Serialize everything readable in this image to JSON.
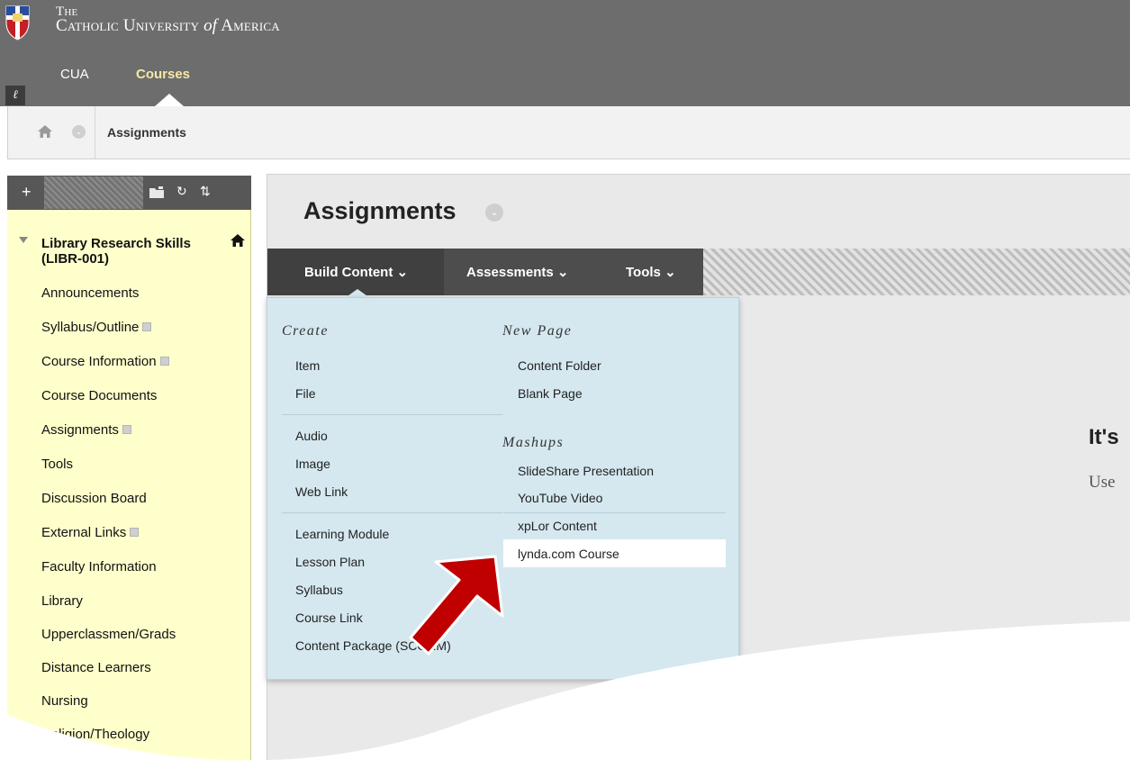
{
  "header": {
    "university_line1": "The",
    "university_line2a": "Catholic University ",
    "university_line2b": "of",
    "university_line2c": " America",
    "tabs": [
      {
        "label": "CUA"
      },
      {
        "label": "Courses"
      }
    ]
  },
  "breadcrumb": {
    "current": "Assignments"
  },
  "course_menu": {
    "course_title_line1": "Library Research Skills",
    "course_title_line2": "(LIBR-001)",
    "items": [
      {
        "label": "Announcements",
        "hidden": false
      },
      {
        "label": "Syllabus/Outline",
        "hidden": true
      },
      {
        "label": "Course Information",
        "hidden": true
      },
      {
        "label": "Course Documents",
        "hidden": false
      },
      {
        "label": "Assignments",
        "hidden": true
      },
      {
        "label": "Tools",
        "hidden": false
      },
      {
        "label": "Discussion Board",
        "hidden": false
      },
      {
        "label": "External Links",
        "hidden": true
      },
      {
        "label": "Faculty Information",
        "hidden": false
      },
      {
        "label": "Library",
        "hidden": false
      },
      {
        "label": "Upperclassmen/Grads",
        "hidden": false
      },
      {
        "label": "Distance Learners",
        "hidden": false
      },
      {
        "label": "Nursing",
        "hidden": false
      },
      {
        "label": "Religion/Theology",
        "hidden": false
      }
    ]
  },
  "content": {
    "page_title": "Assignments",
    "actions": {
      "build": "Build Content",
      "assessments": "Assessments",
      "tools": "Tools"
    },
    "empty_heading": "It's",
    "empty_sub": "Use"
  },
  "dropdown": {
    "create_heading": "Create",
    "new_page_heading": "New Page",
    "mashups_heading": "Mashups",
    "create_items": [
      "Item",
      "File",
      "Audio",
      "Image",
      "Web Link",
      "Learning Module",
      "Lesson Plan",
      "Syllabus",
      "Course Link",
      "Content Package (SCORM)"
    ],
    "new_page_items": [
      "Content Folder",
      "Blank Page"
    ],
    "mashup_items": [
      "SlideShare Presentation",
      "YouTube Video",
      "xpLor Content",
      "lynda.com Course"
    ]
  },
  "colors": {
    "header_bg": "#6d6d6d",
    "active_tab": "#f6e8a5",
    "menu_bg": "#ffffcc",
    "dropdown_bg": "#d5e8f0",
    "action_bar": "#4d4d4d",
    "arrow": "#c00000"
  }
}
